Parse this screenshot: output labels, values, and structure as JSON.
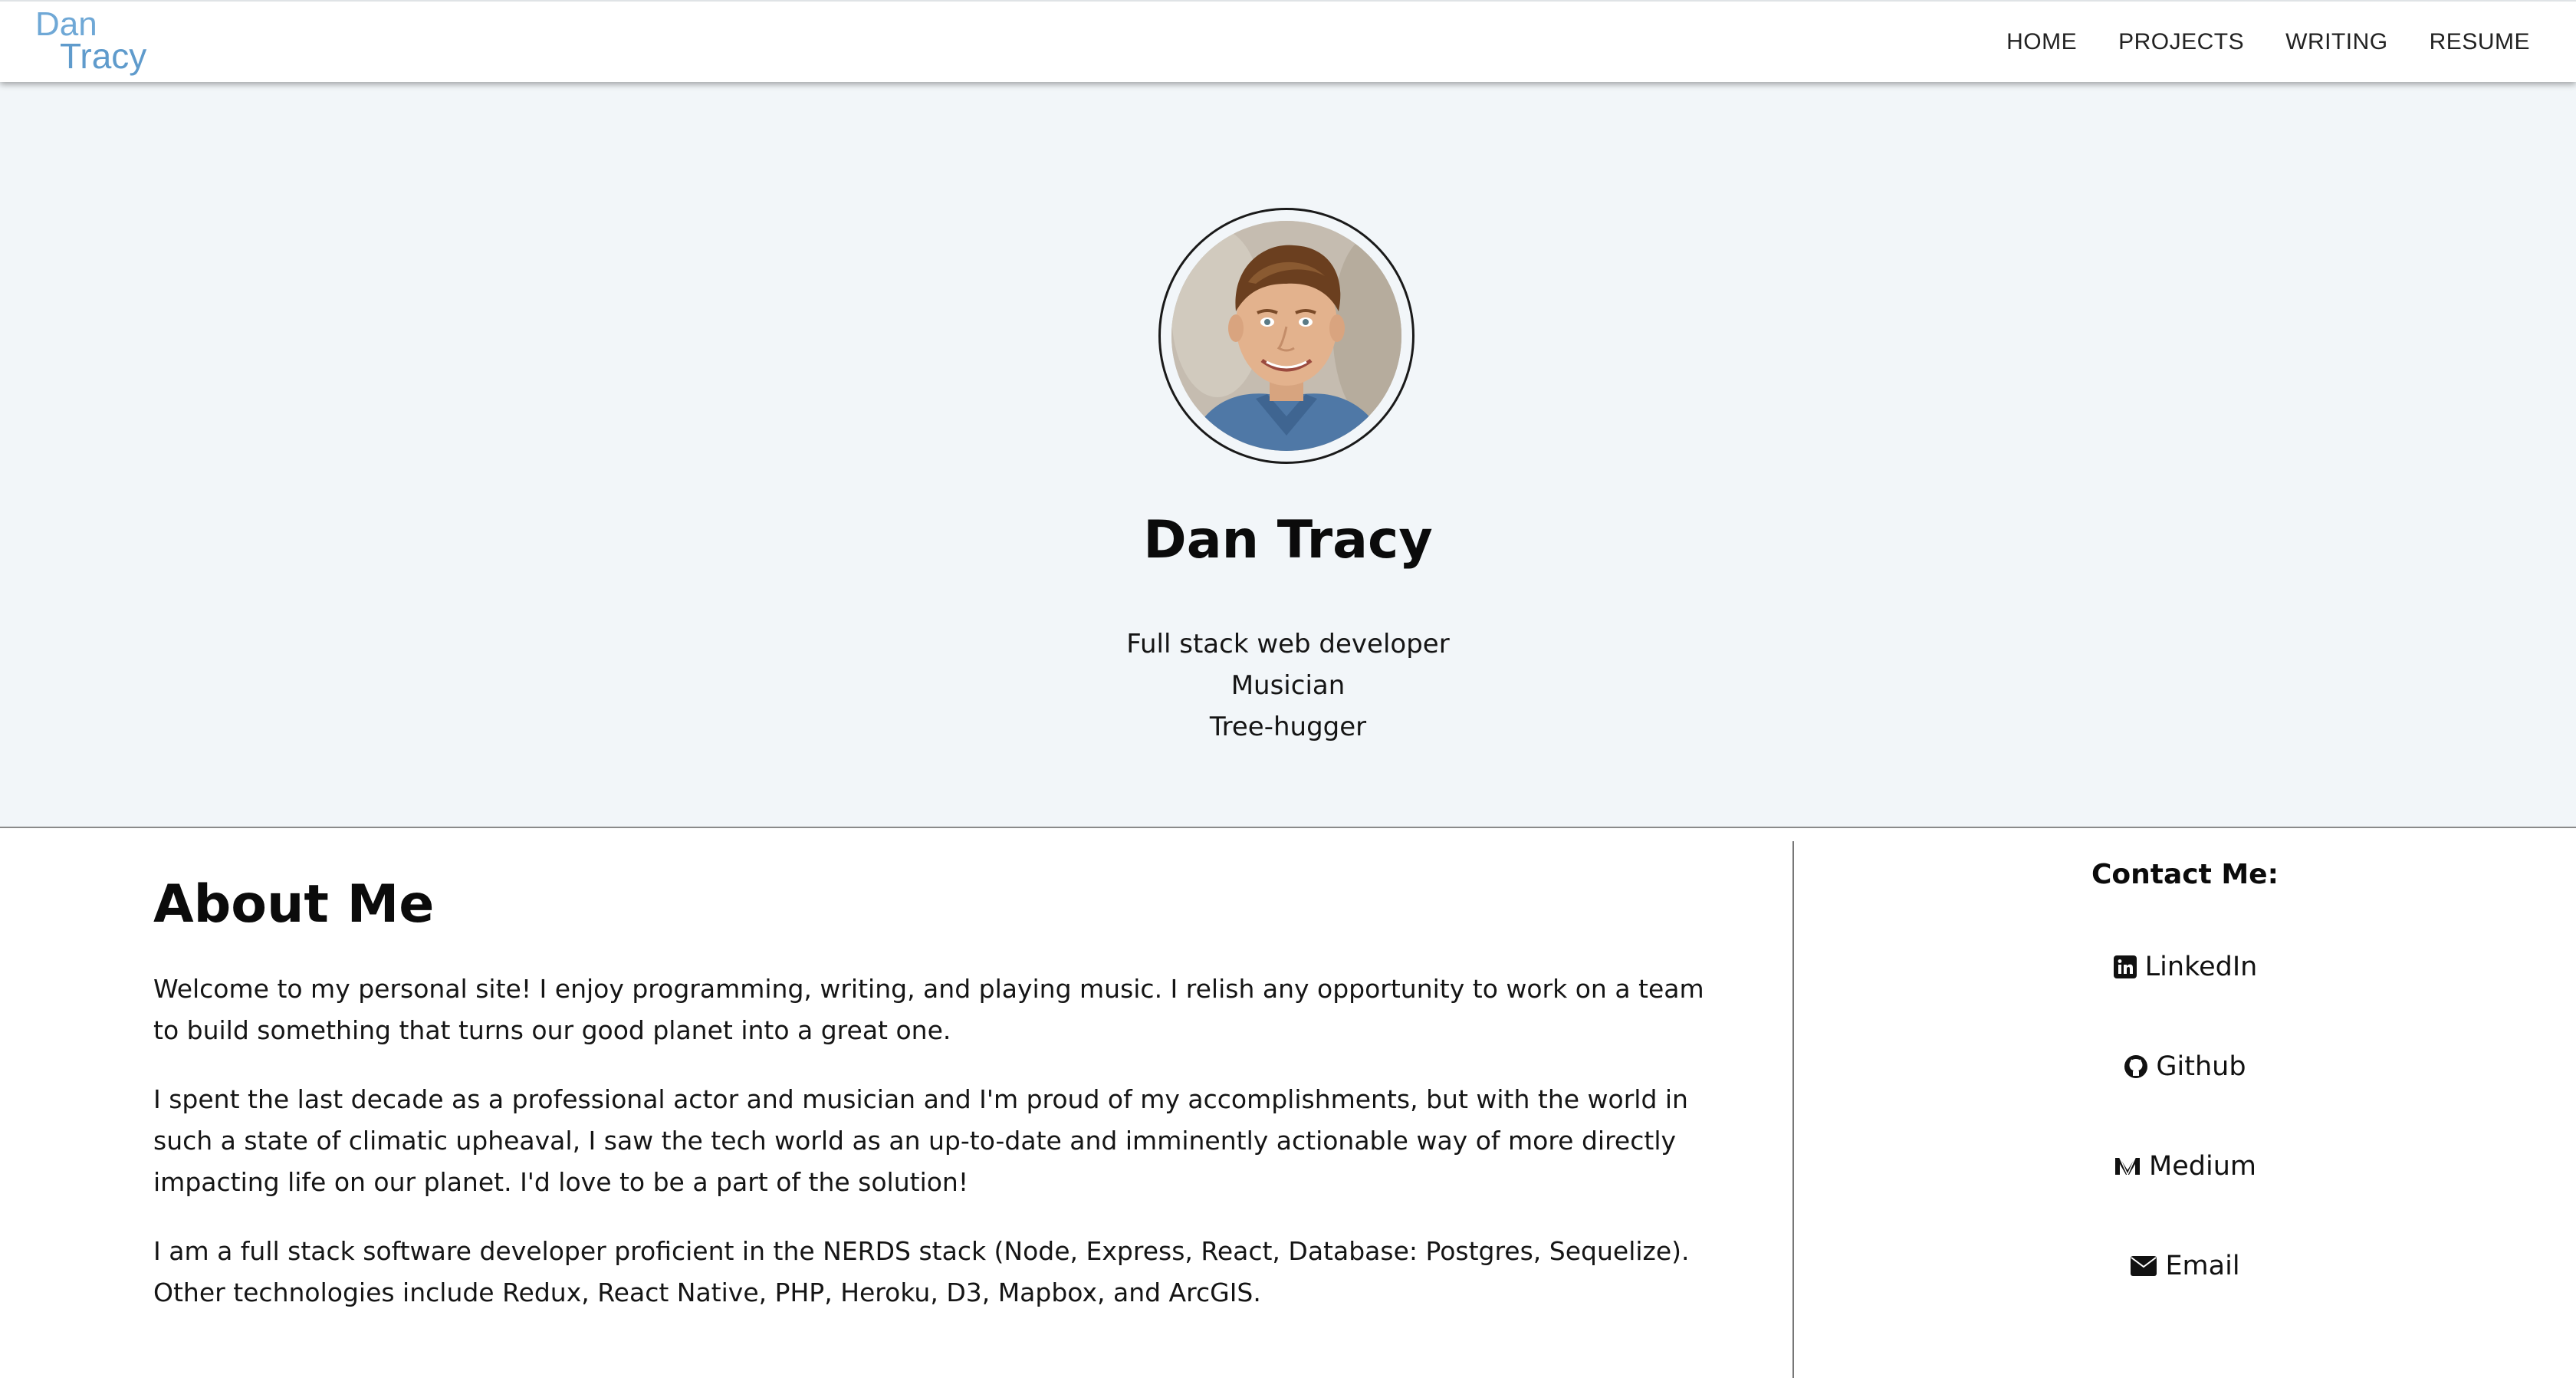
{
  "logo": {
    "line1": "Dan",
    "line2": "Tracy"
  },
  "nav": {
    "items": [
      {
        "label": "HOME"
      },
      {
        "label": "PROJECTS"
      },
      {
        "label": "WRITING"
      },
      {
        "label": "RESUME"
      }
    ]
  },
  "hero": {
    "name": "Dan Tracy",
    "tags": [
      "Full stack web developer",
      "Musician",
      "Tree-hugger"
    ]
  },
  "about": {
    "title": "About Me",
    "paragraphs": [
      "Welcome to my personal site! I enjoy programming, writing, and playing music. I relish any opportunity to work on a team to build something that turns our good planet into a great one.",
      "I spent the last decade as a professional actor and musician and I'm proud of my accomplishments, but with the world in such a state of climatic upheaval, I saw the tech world as an up-to-date and imminently actionable way of more directly impacting life on our planet. I'd love to be a part of the solution!",
      "I am a full stack software developer proficient in the NERDS stack (Node, Express, React, Database: Postgres, Sequelize). Other technologies include Redux, React Native, PHP, Heroku, D3, Mapbox, and ArcGIS."
    ]
  },
  "contact": {
    "title": "Contact Me:",
    "items": [
      {
        "label": "LinkedIn",
        "icon": "linkedin-icon"
      },
      {
        "label": "Github",
        "icon": "github-icon"
      },
      {
        "label": "Medium",
        "icon": "medium-icon"
      },
      {
        "label": "Email",
        "icon": "envelope-icon"
      }
    ]
  },
  "colors": {
    "logo": "#6fa8d6",
    "hero_bg": "#f2f6f9"
  }
}
